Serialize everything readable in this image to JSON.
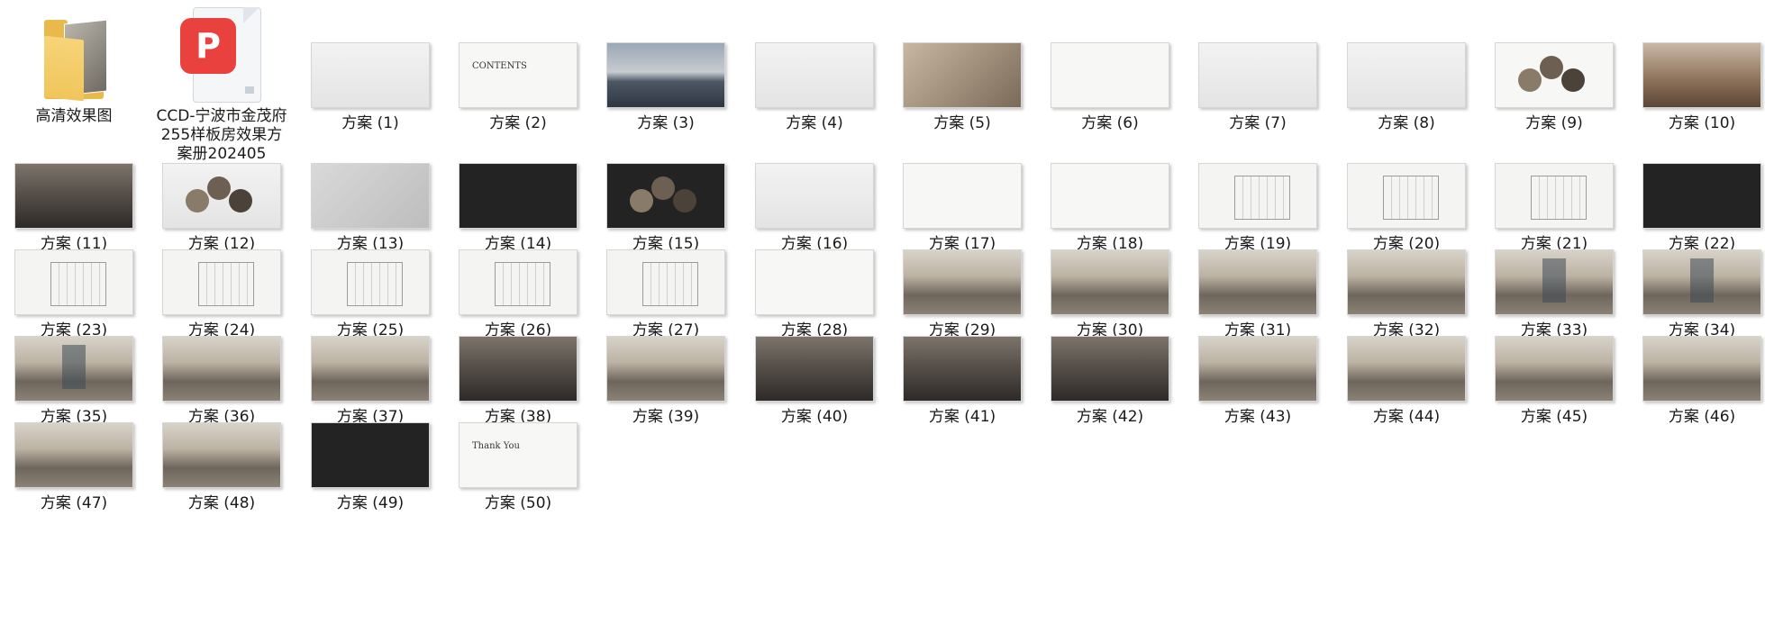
{
  "folder": {
    "name": "高清效果图",
    "icon": "folder-icon"
  },
  "pdf": {
    "name": "CCD-宁波市金茂府255样板房效果方案册202405",
    "icon": "pdf-file-icon",
    "badge": "P"
  },
  "files": [
    "方案 (1)",
    "方案 (2)",
    "方案 (3)",
    "方案 (4)",
    "方案 (5)",
    "方案 (6)",
    "方案 (7)",
    "方案 (8)",
    "方案 (9)",
    "方案 (10)",
    "方案 (11)",
    "方案 (12)",
    "方案 (13)",
    "方案 (14)",
    "方案 (15)",
    "方案 (16)",
    "方案 (17)",
    "方案 (18)",
    "方案 (19)",
    "方案 (20)",
    "方案 (21)",
    "方案 (22)",
    "方案 (23)",
    "方案 (24)",
    "方案 (25)",
    "方案 (26)",
    "方案 (27)",
    "方案 (28)",
    "方案 (29)",
    "方案 (30)",
    "方案 (31)",
    "方案 (32)",
    "方案 (33)",
    "方案 (34)",
    "方案 (35)",
    "方案 (36)",
    "方案 (37)",
    "方案 (38)",
    "方案 (39)",
    "方案 (40)",
    "方案 (41)",
    "方案 (42)",
    "方案 (43)",
    "方案 (44)",
    "方案 (45)",
    "方案 (46)",
    "方案 (47)",
    "方案 (48)",
    "方案 (49)",
    "方案 (50)"
  ],
  "thumb_styles": [
    "t-light",
    "t-white t-title",
    "t-city",
    "t-light",
    "t-warm",
    "t-white",
    "t-light",
    "t-light",
    "t-white t-circles",
    "t-sunset",
    "t-roomdark",
    "t-light t-circles",
    "t-grey",
    "t-dark",
    "t-dark t-circles",
    "t-light",
    "t-white",
    "t-white",
    "t-plan",
    "t-plan",
    "t-plan",
    "t-dark",
    "t-plan",
    "t-plan",
    "t-plan",
    "t-plan",
    "t-plan",
    "t-white",
    "t-room",
    "t-room",
    "t-room",
    "t-room",
    "t-room t-wall",
    "t-room t-wall",
    "t-room t-wall",
    "t-room",
    "t-room",
    "t-roomdark",
    "t-room",
    "t-roomdark",
    "t-roomdark",
    "t-roomdark",
    "t-room",
    "t-room",
    "t-room",
    "t-room",
    "t-room",
    "t-room",
    "t-dark",
    "t-white t-title"
  ],
  "thumb_captions": {
    "1": "CONTENTS",
    "49": "Thank You"
  }
}
